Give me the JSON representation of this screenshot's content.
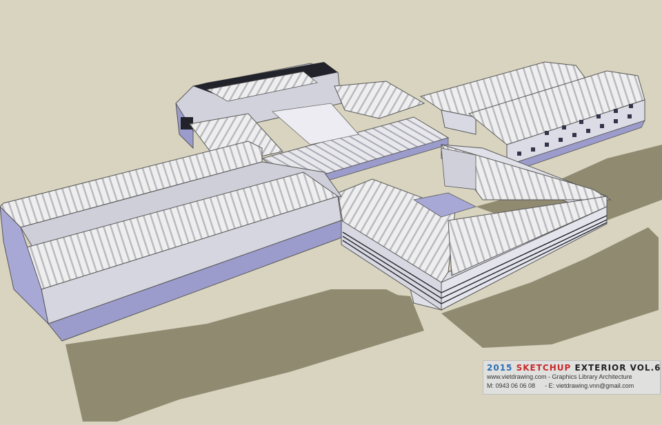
{
  "scene": {
    "colors": {
      "background": "#d8d4c0",
      "shadow": "#8f8a70",
      "roof": "#ededed",
      "roof_rib": "#b9b9c0",
      "wall_light": "#d9d9e4",
      "wall_shade": "#9c9ccc",
      "dark": "#22222a"
    }
  },
  "watermark": {
    "year": "2015",
    "brand": "SKETCHUP",
    "collection": "EXTERIOR VOL.6",
    "site_line": "www.vietdrawing.com - Graphics Library Architecture",
    "phone": "M: 0943 06 06 08",
    "email": "- E: vietdrawing.vnn@gmail.com"
  }
}
